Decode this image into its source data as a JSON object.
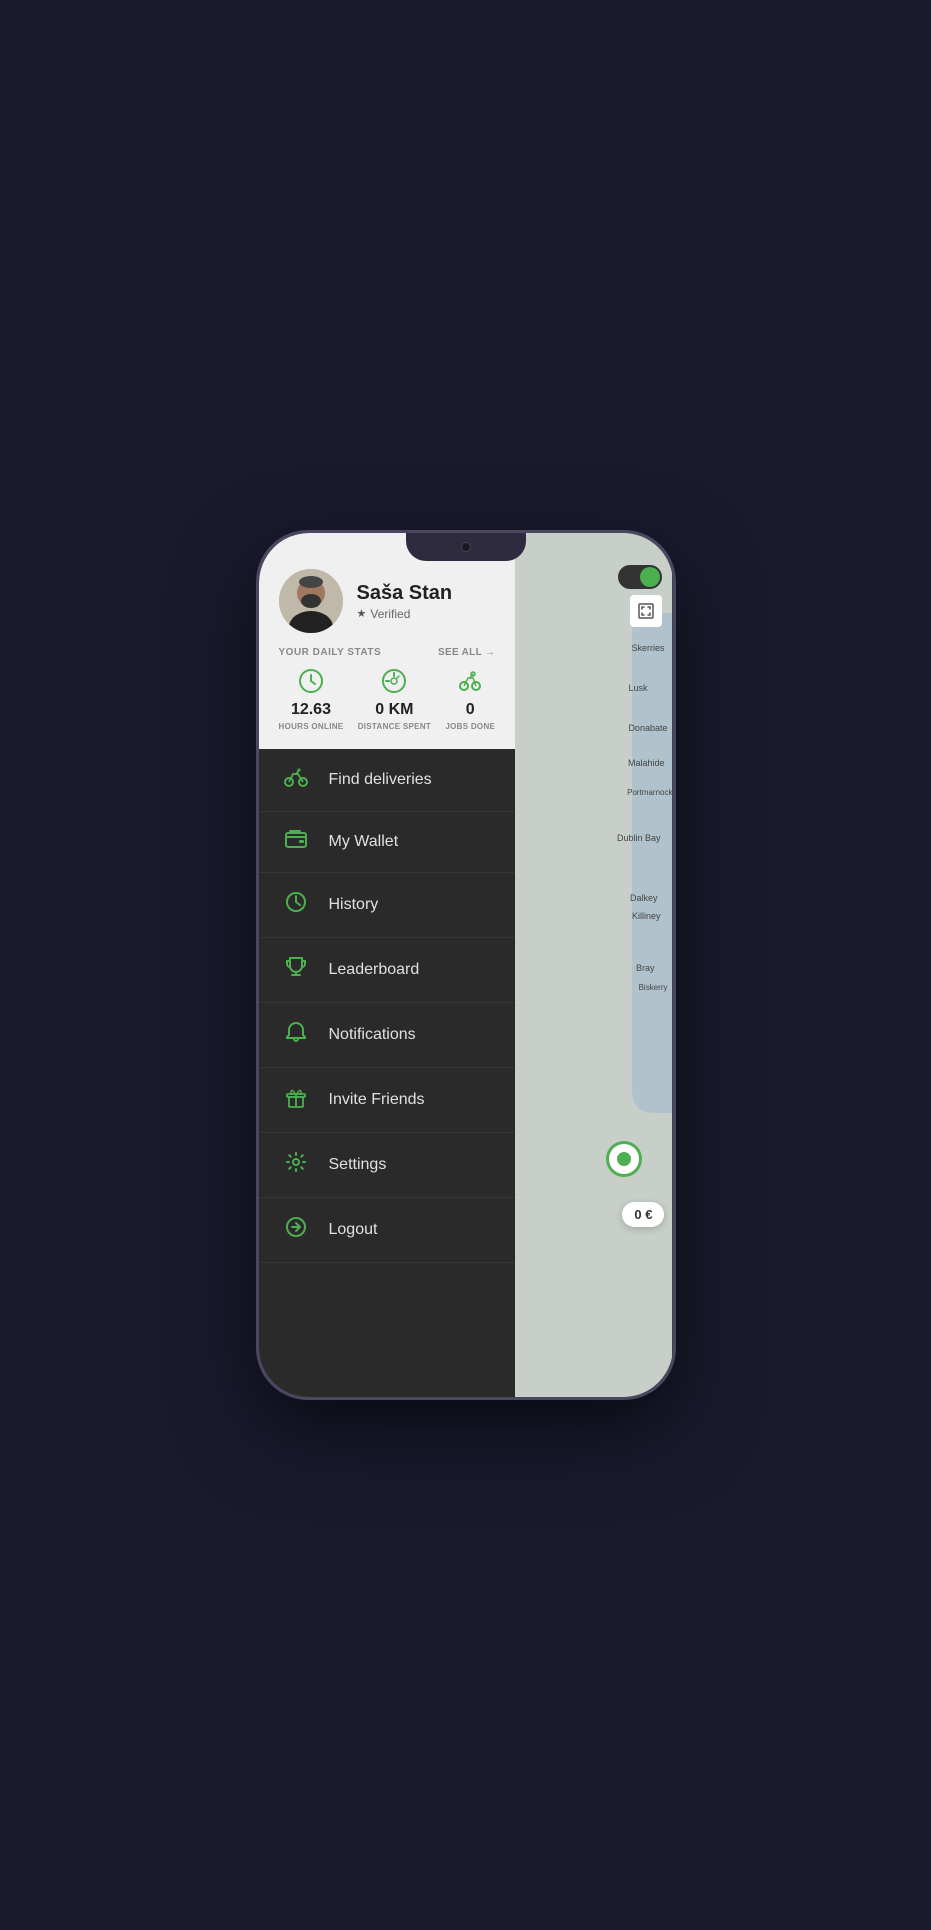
{
  "profile": {
    "name": "Saša Stan",
    "verified_label": "Verified",
    "avatar_alt": "User avatar"
  },
  "stats": {
    "title": "YOUR DAILY STATS",
    "see_all": "SEE ALL →",
    "items": [
      {
        "value": "12.63",
        "label": "HOURS ONLINE",
        "icon": "clock"
      },
      {
        "value": "0 KM",
        "label": "DISTANCE SPENT",
        "icon": "speedometer"
      },
      {
        "value": "0",
        "label": "JOBS DONE",
        "icon": "bicycle"
      }
    ]
  },
  "menu": {
    "items": [
      {
        "id": "find-deliveries",
        "label": "Find deliveries",
        "icon": "bicycle"
      },
      {
        "id": "my-wallet",
        "label": "My Wallet",
        "icon": "wallet"
      },
      {
        "id": "history",
        "label": "History",
        "icon": "clock"
      },
      {
        "id": "leaderboard",
        "label": "Leaderboard",
        "icon": "trophy"
      },
      {
        "id": "notifications",
        "label": "Notifications",
        "icon": "bell"
      },
      {
        "id": "invite-friends",
        "label": "Invite Friends",
        "icon": "gift"
      },
      {
        "id": "settings",
        "label": "Settings",
        "icon": "gear"
      },
      {
        "id": "logout",
        "label": "Logout",
        "icon": "logout"
      }
    ]
  },
  "map": {
    "toggle_state": "on",
    "euro_badge": "0 €",
    "city_labels": [
      "Skerries",
      "Lusk",
      "Donabate",
      "Malahide",
      "Portmarnock",
      "Dublin Bay",
      "Dalkey",
      "Killiney",
      "Bray",
      "Biskerry"
    ]
  }
}
